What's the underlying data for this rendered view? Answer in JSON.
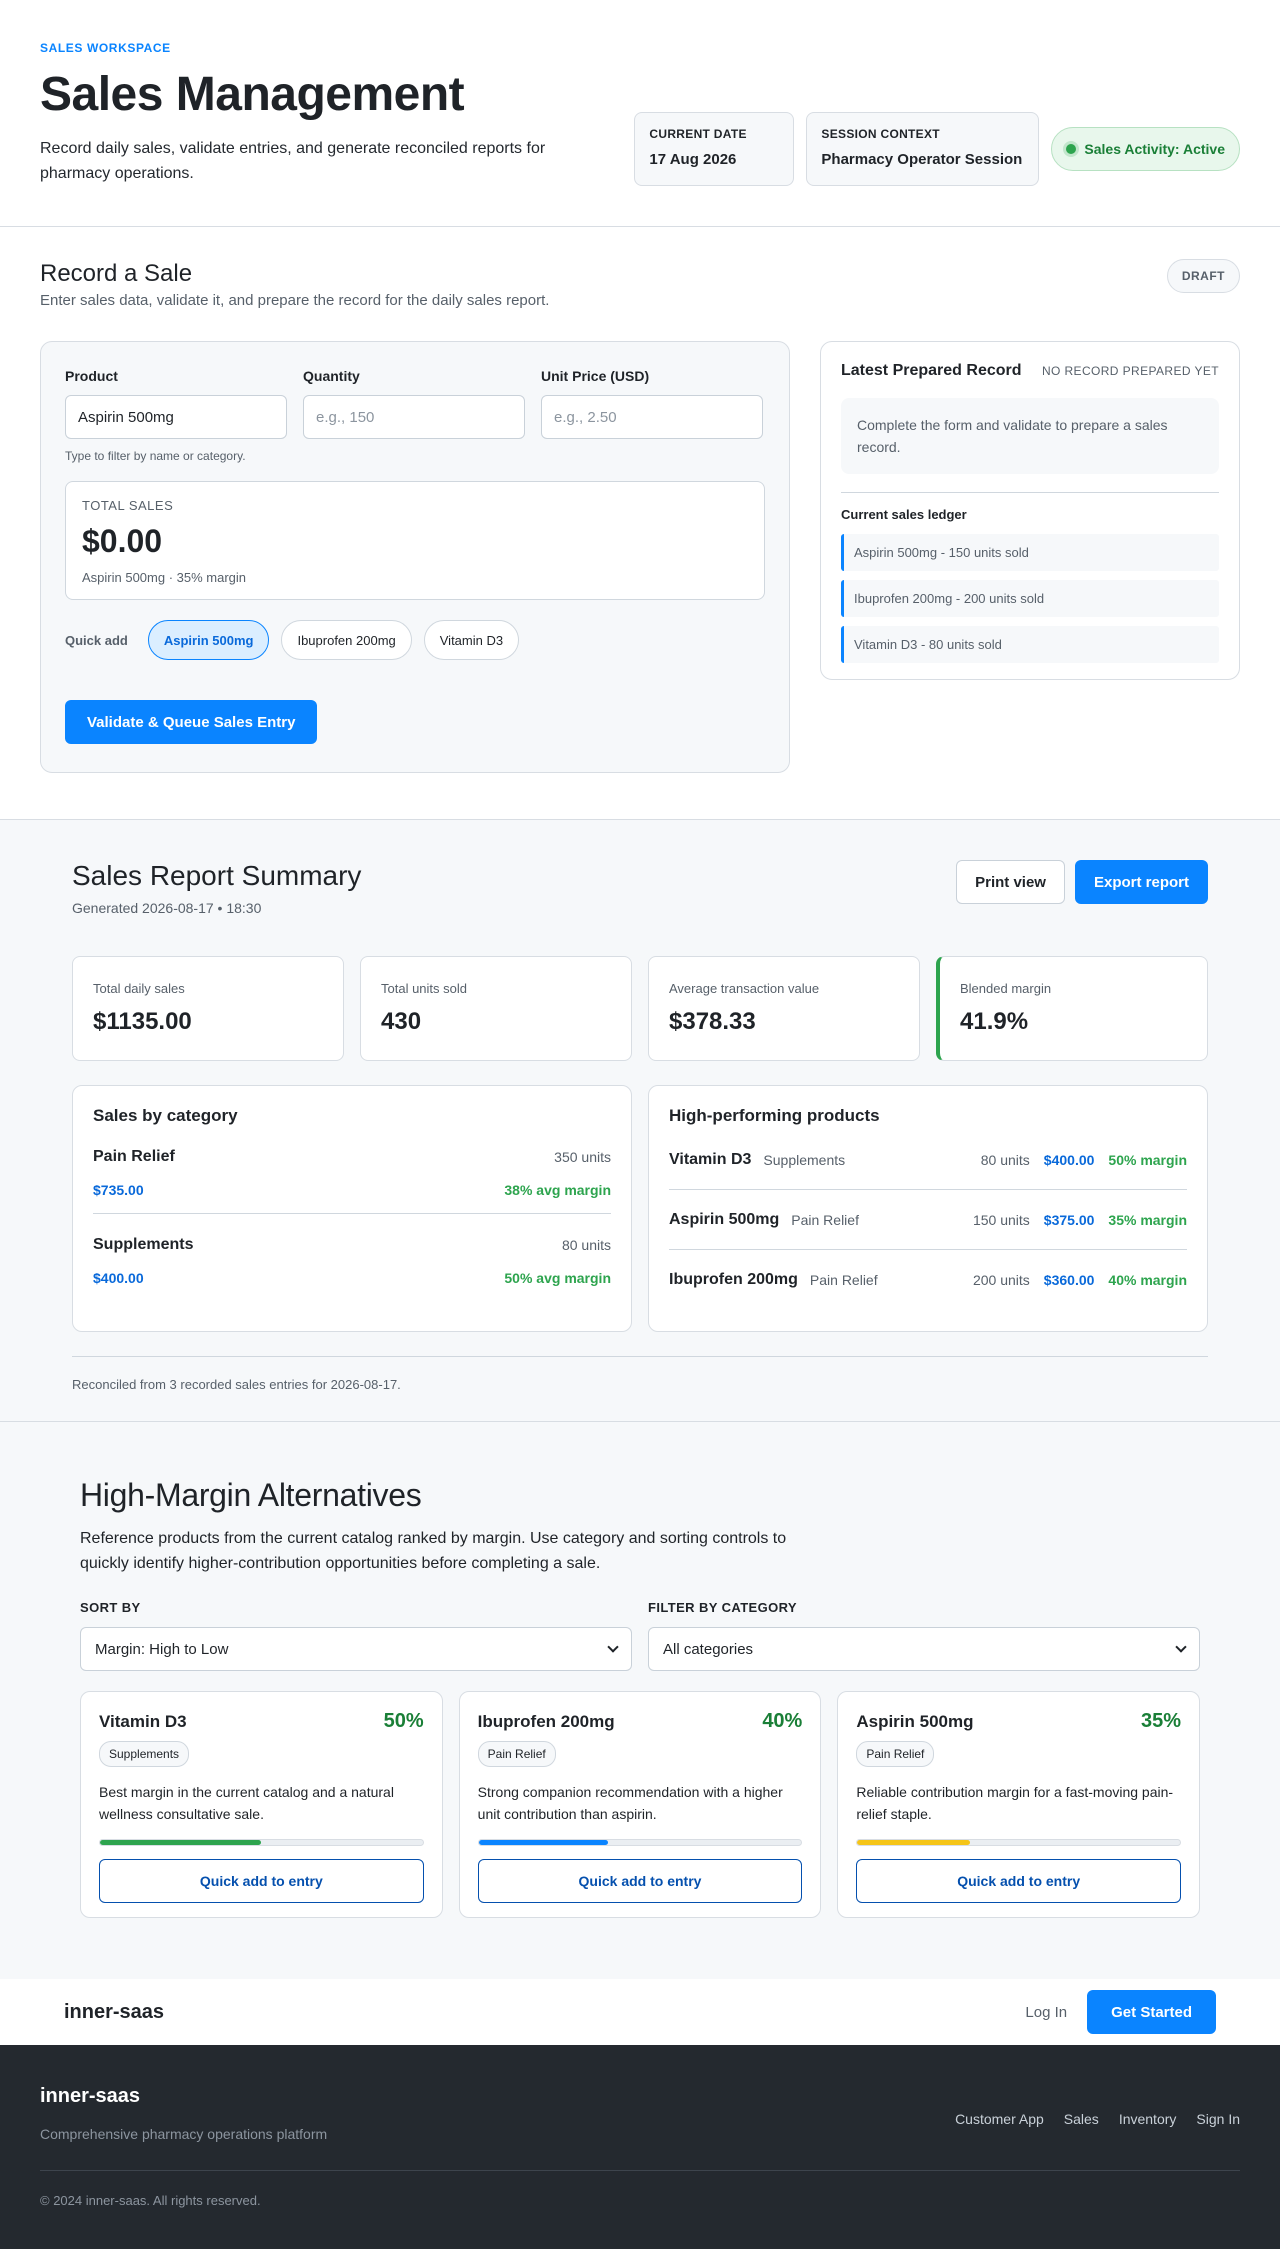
{
  "header": {
    "eyebrow": "SALES WORKSPACE",
    "title": "Sales Management",
    "subtitle": "Record daily sales, validate entries, and generate reconciled reports for pharmacy operations.",
    "date_label": "CURRENT DATE",
    "date_value": "17 Aug 2026",
    "session_label": "SESSION CONTEXT",
    "session_value": "Pharmacy Operator Session",
    "activity": "Sales Activity: Active"
  },
  "record": {
    "title": "Record a Sale",
    "subtitle": "Enter sales data, validate it, and prepare the record for the daily sales report.",
    "status_badge": "DRAFT",
    "form": {
      "product_label": "Product",
      "product_value": "Aspirin 500mg",
      "quantity_label": "Quantity",
      "quantity_placeholder": "e.g., 150",
      "price_label": "Unit Price (USD)",
      "price_placeholder": "e.g., 2.50",
      "product_hint": "Type to filter by name or category.",
      "total_label": "TOTAL SALES",
      "total_value": "$0.00",
      "total_detail": "Aspirin 500mg · 35% margin",
      "quick_add_label": "Quick add",
      "quick_add": [
        "Aspirin 500mg",
        "Ibuprofen 200mg",
        "Vitamin D3"
      ],
      "submit_label": "Validate & Queue Sales Entry"
    },
    "latest": {
      "title": "Latest Prepared Record",
      "status": "NO RECORD PREPARED YET",
      "empty_text": "Complete the form and validate to prepare a sales record.",
      "ledger_title": "Current sales ledger",
      "ledger": [
        "Aspirin 500mg - 150 units sold",
        "Ibuprofen 200mg - 200 units sold",
        "Vitamin D3 - 80 units sold"
      ]
    }
  },
  "report": {
    "title": "Sales Report Summary",
    "generated": "Generated 2026-08-17 • 18:30",
    "print_label": "Print view",
    "export_label": "Export report",
    "kpis": [
      {
        "label": "Total daily sales",
        "value": "$1135.00"
      },
      {
        "label": "Total units sold",
        "value": "430"
      },
      {
        "label": "Average transaction value",
        "value": "$378.33"
      },
      {
        "label": "Blended margin",
        "value": "41.9%"
      }
    ],
    "categories_title": "Sales by category",
    "categories": [
      {
        "name": "Pain Relief",
        "units": "350 units",
        "sales": "$735.00",
        "margin": "38% avg margin"
      },
      {
        "name": "Supplements",
        "units": "80 units",
        "sales": "$400.00",
        "margin": "50% avg margin"
      }
    ],
    "products_title": "High-performing products",
    "products": [
      {
        "name": "Vitamin D3",
        "category": "Supplements",
        "units": "80 units",
        "sales": "$400.00",
        "margin": "50% margin"
      },
      {
        "name": "Aspirin 500mg",
        "category": "Pain Relief",
        "units": "150 units",
        "sales": "$375.00",
        "margin": "35% margin"
      },
      {
        "name": "Ibuprofen 200mg",
        "category": "Pain Relief",
        "units": "200 units",
        "sales": "$360.00",
        "margin": "40% margin"
      }
    ],
    "footer": "Reconciled from 3 recorded sales entries for 2026-08-17."
  },
  "alternatives": {
    "title": "High-Margin Alternatives",
    "description": "Reference products from the current catalog ranked by margin. Use category and sorting controls to quickly identify higher-contribution opportunities before completing a sale.",
    "sort_label": "SORT BY",
    "sort_value": "Margin: High to Low",
    "filter_label": "FILTER BY CATEGORY",
    "filter_value": "All categories",
    "button_label": "Quick add to entry",
    "cards": [
      {
        "name": "Vitamin D3",
        "pct": "50%",
        "margin": 0.5,
        "tag": "Supplements",
        "text": "Best margin in the current catalog and a natural wellness consultative sale.",
        "color": "#2da44e"
      },
      {
        "name": "Ibuprofen 200mg",
        "pct": "40%",
        "margin": 0.4,
        "tag": "Pain Relief",
        "text": "Strong companion recommendation with a higher unit contribution than aspirin.",
        "color": "#0a84ff"
      },
      {
        "name": "Aspirin 500mg",
        "pct": "35%",
        "margin": 0.35,
        "tag": "Pain Relief",
        "text": "Reliable contribution margin for a fast-moving pain-relief staple.",
        "color": "#f5c518"
      }
    ]
  },
  "nav": {
    "brand": "inner-saas",
    "login": "Log In",
    "cta": "Get Started"
  },
  "footer": {
    "brand": "inner-saas",
    "tagline": "Comprehensive pharmacy operations platform",
    "links": [
      "Customer App",
      "Sales",
      "Inventory",
      "Sign In"
    ],
    "copyright": "© 2024 inner-saas. All rights reserved."
  },
  "colors": {
    "accent": "#0a84ff",
    "success": "#2da44e",
    "link": "#0969da",
    "footer_bg": "#24292f"
  }
}
